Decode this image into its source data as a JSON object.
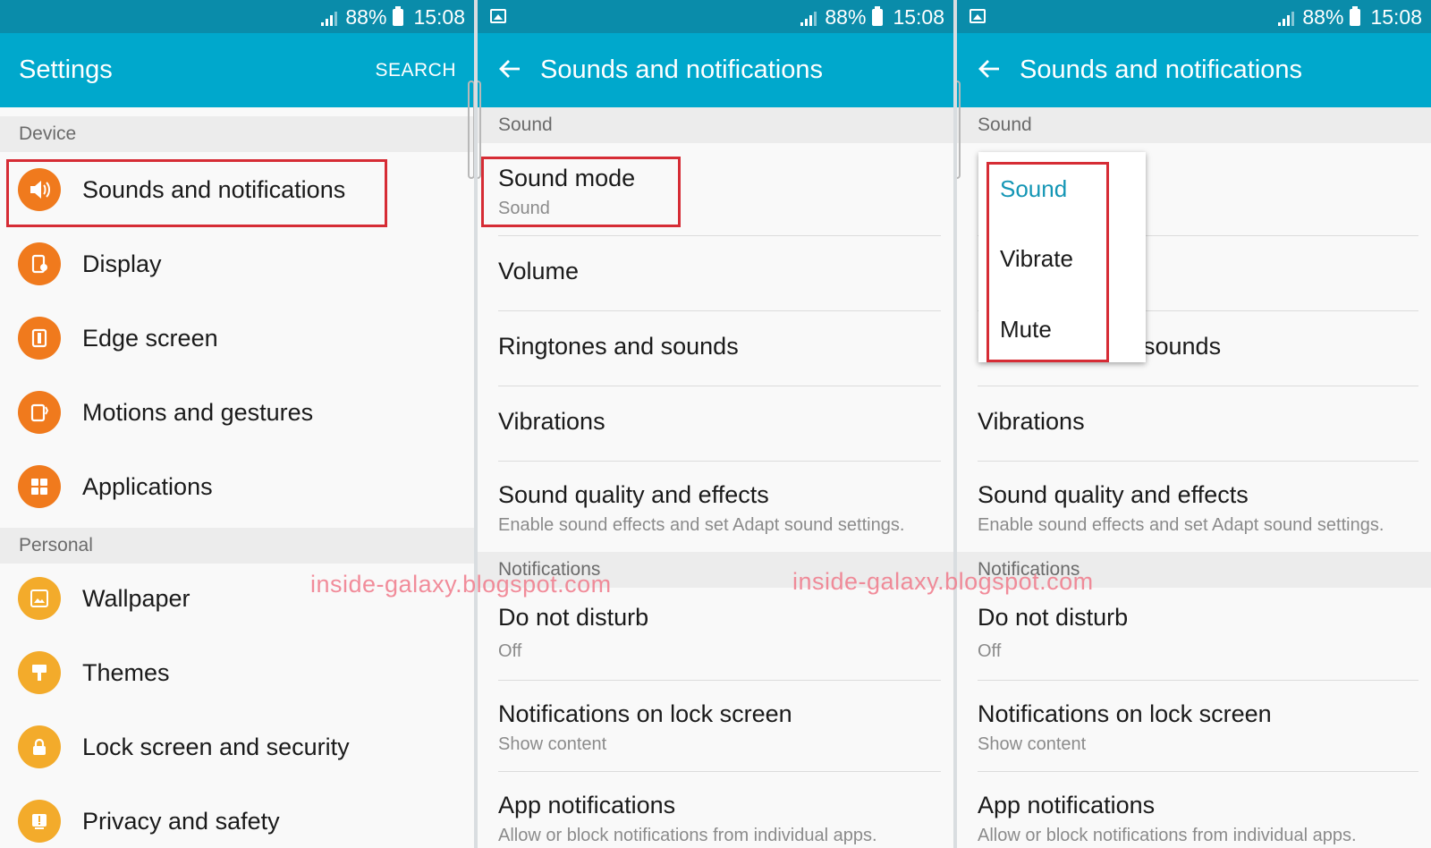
{
  "status": {
    "battery": "88%",
    "time": "15:08"
  },
  "settings": {
    "title": "Settings",
    "search_label": "SEARCH",
    "sections": [
      {
        "header": "Device",
        "items": [
          {
            "label": "Sounds and notifications",
            "icon": "speaker-icon"
          },
          {
            "label": "Display",
            "icon": "display-icon"
          },
          {
            "label": "Edge screen",
            "icon": "edge-screen-icon"
          },
          {
            "label": "Motions and gestures",
            "icon": "motions-icon"
          },
          {
            "label": "Applications",
            "icon": "applications-icon"
          }
        ]
      },
      {
        "header": "Personal",
        "items": [
          {
            "label": "Wallpaper",
            "icon": "wallpaper-icon"
          },
          {
            "label": "Themes",
            "icon": "themes-icon"
          },
          {
            "label": "Lock screen and security",
            "icon": "lock-icon"
          },
          {
            "label": "Privacy and safety",
            "icon": "privacy-icon"
          }
        ]
      }
    ]
  },
  "sounds": {
    "title": "Sounds and notifications",
    "sound_header": "Sound",
    "notifications_header": "Notifications",
    "items": [
      {
        "label": "Sound mode",
        "sub": "Sound"
      },
      {
        "label": "Volume",
        "sub": ""
      },
      {
        "label": "Ringtones and sounds",
        "sub": ""
      },
      {
        "label": "Vibrations",
        "sub": ""
      },
      {
        "label": "Sound quality and effects",
        "sub": "Enable sound effects and set Adapt sound settings."
      },
      {
        "label": "Do not disturb",
        "sub": "Off"
      },
      {
        "label": "Notifications on lock screen",
        "sub": "Show content"
      },
      {
        "label": "App notifications",
        "sub": "Allow or block notifications from individual apps."
      }
    ],
    "partial_ringtones": "sounds"
  },
  "sound_mode_menu": {
    "options": [
      "Sound",
      "Vibrate",
      "Mute"
    ],
    "selected": "Sound"
  },
  "watermark": "inside-galaxy.blogspot.com",
  "colors": {
    "statusbar": "#0a8caa",
    "appbar": "#00a8cc",
    "accent": "#1496b5",
    "icon_orange": "#f07a1d",
    "icon_amber": "#f3ab2b",
    "highlight": "#d62c35"
  }
}
